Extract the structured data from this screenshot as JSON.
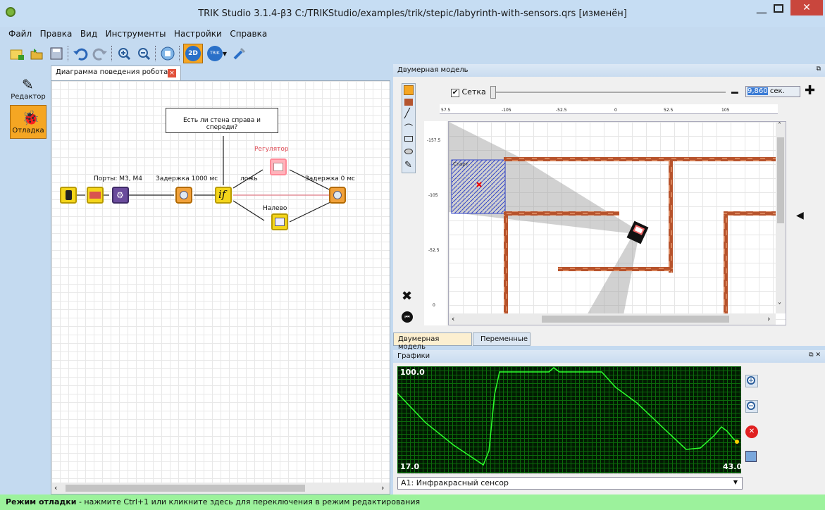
{
  "window": {
    "title": "TRIK Studio 3.1.4-β3 C:/TRIKStudio/examples/trik/stepic/labyrinth-with-sensors.qrs [изменён]"
  },
  "menu": {
    "items": [
      "Файл",
      "Правка",
      "Вид",
      "Инструменты",
      "Настройки",
      "Справка"
    ]
  },
  "toolbar": {
    "btn_2d": "2D",
    "btn_trik": "TRIK"
  },
  "modes": {
    "editor": "Редактор",
    "debug": "Отладка"
  },
  "diagram": {
    "tab_label": "Диаграмма поведения робота",
    "comment": "Есть ли стена справа и спереди?",
    "labels": {
      "ports": "Порты: M3, M4",
      "delay1": "Задержка 1000 мс",
      "regulator": "Регулятор",
      "false_branch": "ложь",
      "left": "Налево",
      "delay2": "Задержка 0 мс"
    }
  },
  "model": {
    "header": "Двумерная модель",
    "grid_label": "Сетка",
    "grid_checked": true,
    "time_value": "9,860",
    "time_unit": "сек.",
    "ruler_x": [
      "57.5",
      "-105",
      "-52.5",
      "0",
      "52.5",
      "105"
    ],
    "ruler_y": [
      "-157.5",
      "-105",
      "-52.5",
      "0"
    ],
    "start_label": "Старт",
    "tabs": [
      "Двумерная модель",
      "Переменные"
    ]
  },
  "graphs": {
    "header": "Графики",
    "y_max": "100.0",
    "y_min": "17.0",
    "x_end": "43.0",
    "sensor_select": "A1: Инфракрасный сенсор"
  },
  "status": {
    "bold": "Режим отладки",
    "text": " - нажмите Ctrl+1 или кликните здесь для переключения в режим редактирования"
  },
  "colors": {
    "accent": "#f5a623",
    "status_bg": "#9cf29c",
    "plot_line": "#2cff2c"
  }
}
